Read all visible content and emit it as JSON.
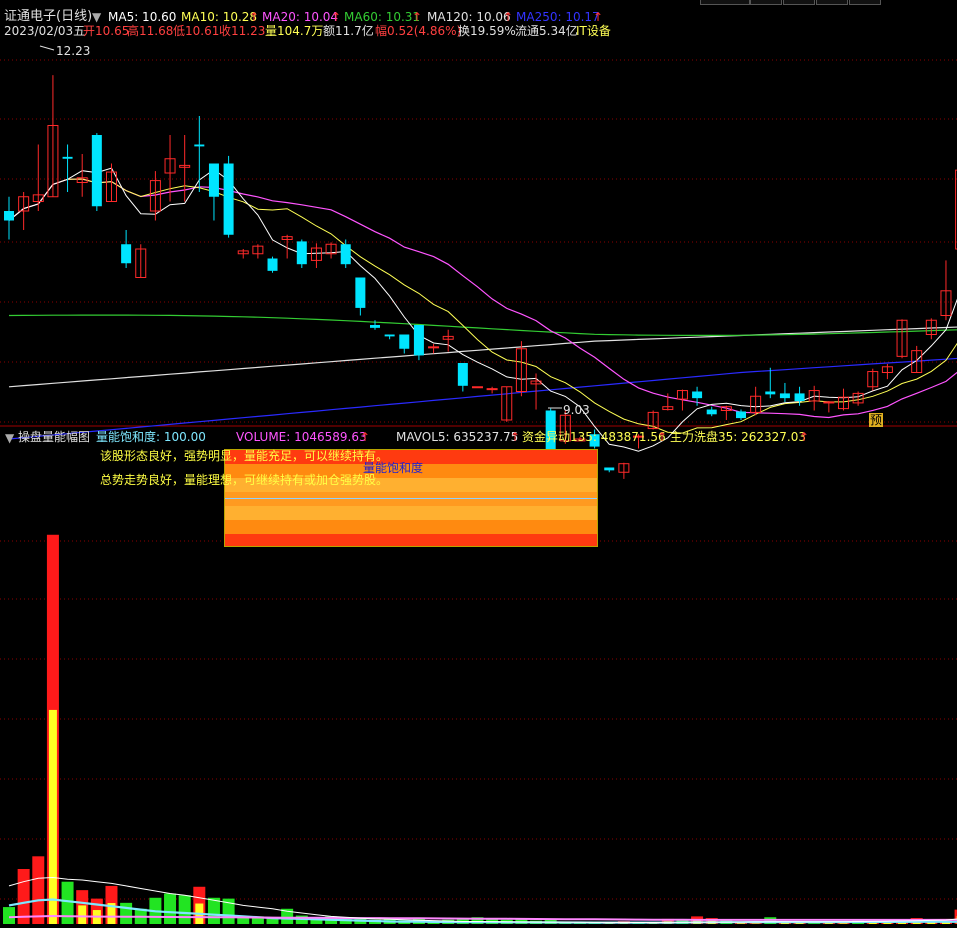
{
  "colors": {
    "up": "#ff2a2a",
    "down": "#00e5ff",
    "bg": "#000000",
    "grid": "#8b0000",
    "ma5": "#ffffff",
    "ma10": "#ffff55",
    "ma20": "#ff55ff",
    "ma60": "#33cc33",
    "ma120": "#e0e0e0",
    "ma250": "#2a2aff",
    "vol_green": "#22e422",
    "vol_red": "#ff1a1a",
    "vol_yellow": "#ffff22",
    "cyan_line": "#7fe8ff",
    "pink_line": "#ff88ff"
  },
  "header": {
    "title": "证通电子(日线)",
    "ma5": "MA5: 10.60",
    "ma10": "MA10: 10.28",
    "ma20": "MA20: 10.04",
    "ma60": "MA60: 10.31",
    "ma120": "MA120: 10.06",
    "ma250": "MA250: 10.17",
    "up_arrow": "↑",
    "date": "2023/02/03五",
    "open": "开10.65",
    "high": "高11.68",
    "low": "低10.61",
    "close": "收11.23",
    "volume": "量104.7万",
    "amount": "额11.7亿",
    "change": "幅0.52(4.86%)",
    "turnover": "换19.59%",
    "float": "流通5.34亿",
    "sector": "IT设备"
  },
  "price_annotations": {
    "high_label": "12.23",
    "low_label": "9.03",
    "forecast_badge": "预"
  },
  "lower_header": {
    "indicator_name": "操盘量能幅图",
    "saturation": "量能饱和度: 100.00",
    "volume": "VOLUME: 1046589.63",
    "mavol5": "MAVOL5: 635237.75",
    "fund_anomaly": "资金异动135: 483871.56",
    "main_wash": "主力洗盘35: 262327.03"
  },
  "panel": {
    "line1": "该股形态良好，强势明显，量能充足，可以继续持有。",
    "line2": "总势走势良好，量能理想，可继续持有或加仓强势股。",
    "box_label": "量能饱和度"
  },
  "chart_data": [
    {
      "type": "candlestick",
      "title": "证通电子(日线)",
      "ylim": [
        8.6,
        12.6
      ],
      "ohlc": [
        [
          10.8,
          10.95,
          10.5,
          10.7
        ],
        [
          10.8,
          11.0,
          10.6,
          10.95
        ],
        [
          10.9,
          11.5,
          10.8,
          10.97
        ],
        [
          10.95,
          12.23,
          10.95,
          11.7
        ],
        [
          11.37,
          11.5,
          11.0,
          11.35
        ],
        [
          11.1,
          11.4,
          10.95,
          11.15
        ],
        [
          11.6,
          11.62,
          10.8,
          10.85
        ],
        [
          10.9,
          11.3,
          10.9,
          11.21
        ],
        [
          10.45,
          10.6,
          10.2,
          10.25
        ],
        [
          10.1,
          10.45,
          10.1,
          10.4
        ],
        [
          10.8,
          11.22,
          10.7,
          11.12
        ],
        [
          11.2,
          11.6,
          10.9,
          11.35
        ],
        [
          11.26,
          11.6,
          10.9,
          11.28
        ],
        [
          11.5,
          11.8,
          11.0,
          11.48
        ],
        [
          11.3,
          11.3,
          10.7,
          10.95
        ],
        [
          11.3,
          11.38,
          10.52,
          10.55
        ],
        [
          10.35,
          10.4,
          10.3,
          10.38
        ],
        [
          10.35,
          10.45,
          10.3,
          10.43
        ],
        [
          10.3,
          10.32,
          10.15,
          10.17
        ],
        [
          10.5,
          10.55,
          10.3,
          10.53
        ],
        [
          10.48,
          10.5,
          10.2,
          10.24
        ],
        [
          10.28,
          10.46,
          10.2,
          10.41
        ],
        [
          10.35,
          10.47,
          10.3,
          10.45
        ],
        [
          10.45,
          10.5,
          10.2,
          10.24
        ],
        [
          10.1,
          10.1,
          9.7,
          9.78
        ],
        [
          9.6,
          9.65,
          9.55,
          9.57
        ],
        [
          9.5,
          9.5,
          9.45,
          9.48
        ],
        [
          9.5,
          9.5,
          9.3,
          9.35
        ],
        [
          9.6,
          9.6,
          9.23,
          9.28
        ],
        [
          9.36,
          9.4,
          9.3,
          9.37
        ],
        [
          9.45,
          9.55,
          9.32,
          9.48
        ],
        [
          9.2,
          9.2,
          8.9,
          8.96
        ],
        [
          8.95,
          8.95,
          8.95,
          8.95
        ],
        [
          8.93,
          8.95,
          8.88,
          8.93
        ],
        [
          8.6,
          8.95,
          8.58,
          8.95
        ],
        [
          8.9,
          9.43,
          8.85,
          9.35
        ],
        [
          8.98,
          9.09,
          8.71,
          9.01
        ],
        [
          8.7,
          8.72,
          8.25,
          8.28
        ],
        [
          8.38,
          8.7,
          8.35,
          8.65
        ],
        [
          8.38,
          8.42,
          8.38,
          8.4
        ],
        [
          8.45,
          8.5,
          8.3,
          8.32
        ],
        [
          8.1,
          8.1,
          8.05,
          8.07
        ],
        [
          8.05,
          8.15,
          7.98,
          8.14
        ],
        [
          8.42,
          8.45,
          8.3,
          8.43
        ],
        [
          8.51,
          8.7,
          8.5,
          8.68
        ],
        [
          8.71,
          8.88,
          8.7,
          8.74
        ],
        [
          8.82,
          8.92,
          8.7,
          8.91
        ],
        [
          8.9,
          8.95,
          8.75,
          8.83
        ],
        [
          8.71,
          8.74,
          8.64,
          8.66
        ],
        [
          8.7,
          8.75,
          8.6,
          8.74
        ],
        [
          8.69,
          8.71,
          8.6,
          8.62
        ],
        [
          8.68,
          8.95,
          8.65,
          8.85
        ],
        [
          8.9,
          9.15,
          8.83,
          8.87
        ],
        [
          8.88,
          8.99,
          8.79,
          8.83
        ],
        [
          8.88,
          8.95,
          8.75,
          8.8
        ],
        [
          8.8,
          8.96,
          8.7,
          8.91
        ],
        [
          8.78,
          8.8,
          8.68,
          8.79
        ],
        [
          8.72,
          8.93,
          8.7,
          8.84
        ],
        [
          8.78,
          8.9,
          8.75,
          8.88
        ],
        [
          8.95,
          9.14,
          8.91,
          9.11
        ],
        [
          9.1,
          9.19,
          9.03,
          9.16
        ],
        [
          9.27,
          9.66,
          9.25,
          9.65
        ],
        [
          9.1,
          9.38,
          9.1,
          9.33
        ],
        [
          9.5,
          9.67,
          9.45,
          9.65
        ],
        [
          9.7,
          10.28,
          9.65,
          9.96
        ],
        [
          10.4,
          11.6,
          10.3,
          11.23
        ]
      ]
    },
    {
      "type": "bar",
      "title": "操盘量能幅图",
      "series": [
        {
          "name": "VOLUME",
          "values": [
            1002000,
            1006500,
            1008000,
            1046000,
            1005000,
            1004000,
            1003000,
            1004500,
            1002500,
            1001800,
            1003100,
            1003600,
            1003400,
            1004400,
            1003100,
            1003000,
            1000900,
            1000900,
            1000800,
            1001800,
            1001000,
            1000600,
            1000900,
            1000800,
            1000700,
            1000500,
            1000550,
            1000450,
            1000600,
            1000400,
            1000500,
            1000700,
            1000800,
            1000600,
            1000500,
            1000600,
            1000400,
            1000550,
            1000300,
            1000200,
            1000300,
            1000150,
            1000350,
            1000100,
            1000250,
            1000600,
            1000550,
            1000900,
            1000700,
            1000500,
            1000150,
            1000100,
            1000800,
            1000300,
            1000250,
            1000100,
            1000200,
            1000150,
            1000450,
            1000350,
            1000450,
            1000350,
            1000700,
            1000550,
            1000600,
            1001700
          ]
        },
        {
          "name": "MAVOL5",
          "values": [
            1004500,
            1005000,
            1005400,
            1005500,
            1005300,
            1005200,
            1005000,
            1004800,
            1004500,
            1004200,
            1003900,
            1003600,
            1003400,
            1003100,
            1002800,
            1002500,
            1002200,
            1002000,
            1001800,
            1001500,
            1001300,
            1001100,
            1000900,
            1000800,
            1000700,
            1000600,
            1000550,
            1000500,
            1000450,
            1000400,
            1000350,
            1000300,
            1000300,
            1000280,
            1000260,
            1000250,
            1000240,
            1000230,
            1000220,
            1000200,
            1000190,
            1000190,
            1000180,
            1000180,
            1000180,
            1000190,
            1000200,
            1000200,
            1000220,
            1000230,
            1000240,
            1000250,
            1000260,
            1000260,
            1000260,
            1000250,
            1000260,
            1000270,
            1000290,
            1000310,
            1000330,
            1000360,
            1000390,
            1000420,
            1000460,
            1000635
          ]
        },
        {
          "name": "资金异动135",
          "values": [
            1000800,
            1000850,
            1000900,
            1000950,
            1000920,
            1000900,
            1000880,
            1000870,
            1000860,
            1000850,
            1000840,
            1000830,
            1000820,
            1000810,
            1000800,
            1000790,
            1000780,
            1000770,
            1000760,
            1000750,
            1000740,
            1000730,
            1000720,
            1000710,
            1000700,
            1000700,
            1000690,
            1000680,
            1000670,
            1000660,
            1000650,
            1000640,
            1000630,
            1000620,
            1000610,
            1000600,
            1000590,
            1000580,
            1000570,
            1000560,
            1000550,
            1000540,
            1000530,
            1000520,
            1000510,
            1000500,
            1000500,
            1000490,
            1000490,
            1000480,
            1000480,
            1000480,
            1000480,
            1000480,
            1000480,
            1000480,
            1000480,
            1000480,
            1000480,
            1000480,
            1000480,
            1000480,
            1000480,
            1000480,
            1000480,
            1000484
          ]
        },
        {
          "name": "主力洗盘35",
          "values": [
            1002200,
            1002500,
            1002800,
            1002900,
            1002700,
            1002500,
            1002300,
            1002100,
            1001900,
            1001700,
            1001500,
            1001400,
            1001300,
            1001200,
            1001100,
            1001000,
            1000900,
            1000800,
            1000700,
            1000650,
            1000600,
            1000550,
            1000500,
            1000450,
            1000400,
            1000350,
            1000300,
            1000280,
            1000270,
            1000250,
            1000240,
            1000230,
            1000220,
            1000210,
            1000200,
            1000200,
            1000190,
            1000190,
            1000180,
            1000180,
            1000170,
            1000170,
            1000170,
            1000170,
            1000170,
            1000170,
            1000180,
            1000190,
            1000200,
            1000210,
            1000210,
            1000220,
            1000220,
            1000220,
            1000230,
            1000230,
            1000230,
            1000240,
            1000240,
            1000250,
            1000250,
            1000250,
            1000255,
            1000260,
            1000262,
            1000262
          ]
        }
      ]
    }
  ]
}
